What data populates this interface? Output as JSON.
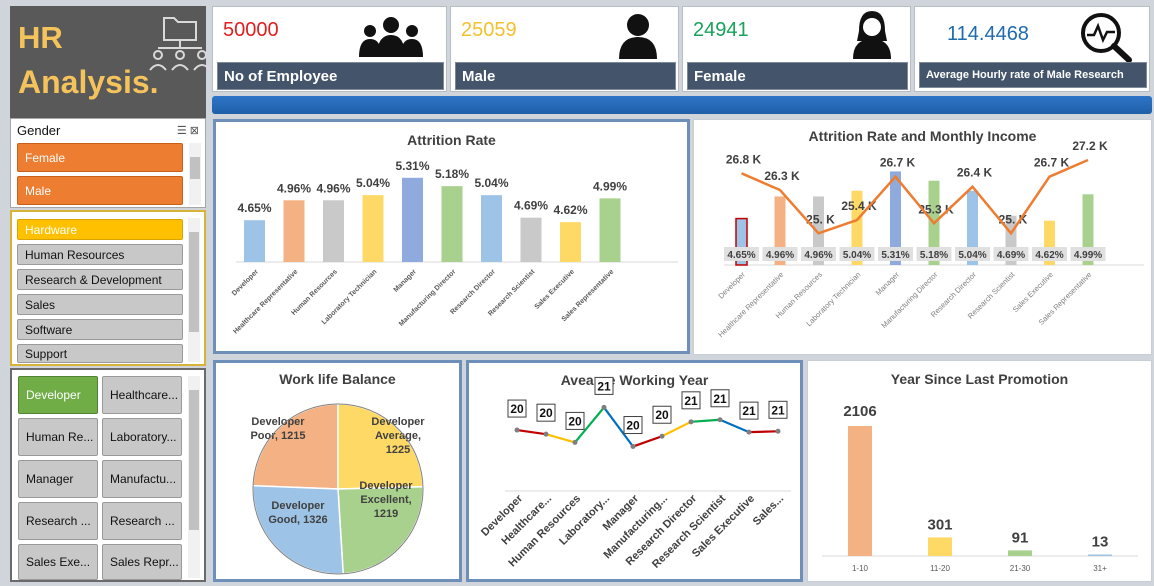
{
  "title": {
    "line1": "HR",
    "line2": "Analysis."
  },
  "kpis": [
    {
      "value": "50000",
      "label": "No of Employee",
      "color": "#e02020",
      "icon": "people-group-icon"
    },
    {
      "value": "25059",
      "label": "Male",
      "color": "#f2c12e",
      "icon": "male-user-icon"
    },
    {
      "value": "24941",
      "label": "Female",
      "color": "#17a35a",
      "icon": "female-user-icon"
    },
    {
      "value": "114.4468",
      "label": "Average Hourly rate of Male Research",
      "color": "#1f6bb0",
      "icon": "analytics-magnifier-icon"
    }
  ],
  "slicers": {
    "gender": {
      "header": "Gender",
      "items": [
        "Female",
        "Male"
      ]
    },
    "department": {
      "items": [
        "Hardware",
        "Human Resources",
        "Research & Development",
        "Sales",
        "Software",
        "Support"
      ]
    },
    "role": {
      "items": [
        "Developer",
        "Healthcare...",
        "Human Re...",
        "Laboratory...",
        "Manager",
        "Manufactu...",
        "Research ...",
        "Research ...",
        "Sales Exe...",
        "Sales Repr..."
      ]
    }
  },
  "colors": {
    "accent": "#4472c4",
    "orange": "#f4b183",
    "gray": "#c9c9c9",
    "yellow": "#ffd966",
    "blue": "#8faadc",
    "green": "#a9d18e",
    "lightblue": "#9dc3e6",
    "line": "#ed7d31"
  },
  "chart_data": [
    {
      "type": "bar",
      "title": "Attrition Rate",
      "categories": [
        "Developer",
        "Healthcare Representative",
        "Human Resources",
        "Laboratory Technician",
        "Manager",
        "Manufacturing Director",
        "Research Director",
        "Research Scientist",
        "Sales Executive",
        "Sales Representative"
      ],
      "values": [
        4.65,
        4.96,
        4.96,
        5.04,
        5.31,
        5.18,
        5.04,
        4.69,
        4.62,
        4.99
      ],
      "labels": [
        "4.65%",
        "4.96%",
        "4.96%",
        "5.04%",
        "5.31%",
        "5.18%",
        "5.04%",
        "4.69%",
        "4.62%",
        "4.99%"
      ]
    },
    {
      "type": "bar",
      "title": "Attrition Rate and Monthly Income",
      "categories": [
        "Developer",
        "Healthcare Representative",
        "Human Resources",
        "Laboratory Technician",
        "Manager",
        "Manufacturing Director",
        "Research Director",
        "Research Scientist",
        "Sales Executive",
        "Sales Representative"
      ],
      "series": [
        {
          "values": [
            4.65,
            4.96,
            4.96,
            5.04,
            5.31,
            5.18,
            5.04,
            4.69,
            4.62,
            4.99
          ],
          "labels": [
            "4.65%",
            "4.96%",
            "4.96%",
            "5.04%",
            "5.31%",
            "5.18%",
            "5.04%",
            "4.69%",
            "4.62%",
            "4.99%"
          ]
        },
        {
          "values": [
            26.8,
            26.3,
            25,
            25.4,
            26.7,
            25.3,
            26.4,
            25,
            26.7,
            27.2
          ],
          "labels": [
            "26.8 K",
            "26.3 K",
            "25. K",
            "25.4 K",
            "26.7 K",
            "25.3 K",
            "26.4 K",
            "25. K",
            "26.7 K",
            "27.2 K"
          ]
        }
      ]
    },
    {
      "type": "pie",
      "title": "Work life Balance",
      "slices": [
        {
          "label": "Developer Poor, 1215",
          "value": 1215,
          "color": "#f4b183"
        },
        {
          "label": "Developer Average, 1225",
          "value": 1225,
          "color": "#ffd966"
        },
        {
          "label": "Developer Excellent, 1219",
          "value": 1219,
          "color": "#a9d18e"
        },
        {
          "label": "Developer Good, 1326",
          "value": 1326,
          "color": "#9dc3e6"
        }
      ]
    },
    {
      "type": "line",
      "title": "Avearge Working Year",
      "categories": [
        "Developer",
        "Healthcare...",
        "Human Resources",
        "Laboratory...",
        "Manager",
        "Manufacturing...",
        "Research Director",
        "Research Scientist",
        "Sales Executive",
        "Sales..."
      ],
      "values": [
        20,
        20,
        20,
        21,
        20,
        20,
        21,
        21,
        21,
        21
      ],
      "plot": [
        20.3,
        20.2,
        20.0,
        20.85,
        19.9,
        20.15,
        20.5,
        20.55,
        20.25,
        20.27
      ]
    },
    {
      "type": "bar",
      "title": "Year Since Last Promotion",
      "categories": [
        "1-10",
        "11-20",
        "21-30",
        "31+"
      ],
      "values": [
        2106,
        301,
        91,
        13
      ]
    }
  ]
}
